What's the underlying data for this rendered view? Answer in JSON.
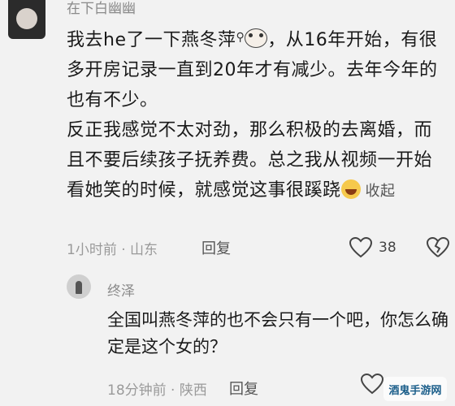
{
  "comment1": {
    "username": "在下白幽幽",
    "text_part1": "我去he了一下燕冬萍",
    "text_part2": "，从16年开始，有很多开房记录一直到20年才有减少。去年今年的也有不少。",
    "text_part3": "反正我感觉不太对劲，那么积极的去离婚，而且不要后续孩子抚养费。总之我从视频一开始看她笑的时候，就感觉这事很蹊跷",
    "collapse_label": "收起",
    "time": "1小时前",
    "location": "山东",
    "reply_label": "回复",
    "like_count": "38"
  },
  "comment2": {
    "username": "终泽",
    "text": "全国叫燕冬萍的也不会只有一个吧，你怎么确定是这个女的？",
    "time": "18分钟前",
    "location": "陕西",
    "reply_label": "回复"
  },
  "watermark": "酒鬼手游网",
  "icons": {
    "search_emoji": "magnifier-icon",
    "dog_emoji": "dog-emoji-icon",
    "laugh_emoji": "laugh-cry-emoji-icon",
    "like": "heart-icon",
    "dislike": "broken-heart-icon"
  }
}
